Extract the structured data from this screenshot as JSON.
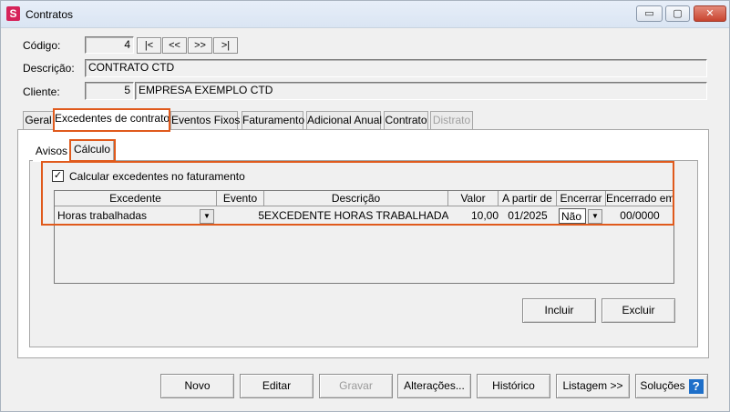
{
  "window": {
    "title": "Contratos",
    "app_icon_letter": "S",
    "minimize": "▭",
    "maximize": "▢",
    "close": "✕"
  },
  "header": {
    "codigo_label": "Código:",
    "codigo_value": "4",
    "nav_first": "|<",
    "nav_prev": "<<",
    "nav_next": ">>",
    "nav_last": ">|",
    "descricao_label": "Descrição:",
    "descricao_value": "CONTRATO CTD",
    "cliente_label": "Cliente:",
    "cliente_code": "5",
    "cliente_name": "EMPRESA EXEMPLO CTD"
  },
  "tabs": [
    {
      "label": "Geral"
    },
    {
      "label": "Excedentes de contrato"
    },
    {
      "label": "Eventos Fixos"
    },
    {
      "label": "Faturamento"
    },
    {
      "label": "Adicional Anual"
    },
    {
      "label": "Contrato"
    },
    {
      "label": "Distrato"
    }
  ],
  "subtabs": [
    {
      "label": "Avisos"
    },
    {
      "label": "Cálculo"
    }
  ],
  "calculo": {
    "checkbox_label": "Calcular excedentes no faturamento",
    "checked_mark": "✓",
    "columns": [
      "Excedente",
      "Evento",
      "Descrição",
      "Valor",
      "A partir de",
      "Encerrar",
      "Encerrado em"
    ],
    "row": {
      "excedente": "Horas trabalhadas",
      "evento": "5",
      "descricao": "EXCEDENTE HORAS TRABALHADAS",
      "valor": "10,00",
      "a_partir_de": "01/2025",
      "encerrar": "Não",
      "encerrado_em": "00/0000"
    },
    "incluir": "Incluir",
    "excluir": "Excluir"
  },
  "footer": {
    "novo": "Novo",
    "editar": "Editar",
    "gravar": "Gravar",
    "alteracoes": "Alterações...",
    "historico": "Histórico",
    "listagem": "Listagem >>",
    "solucoes": "Soluções",
    "help": "?"
  }
}
